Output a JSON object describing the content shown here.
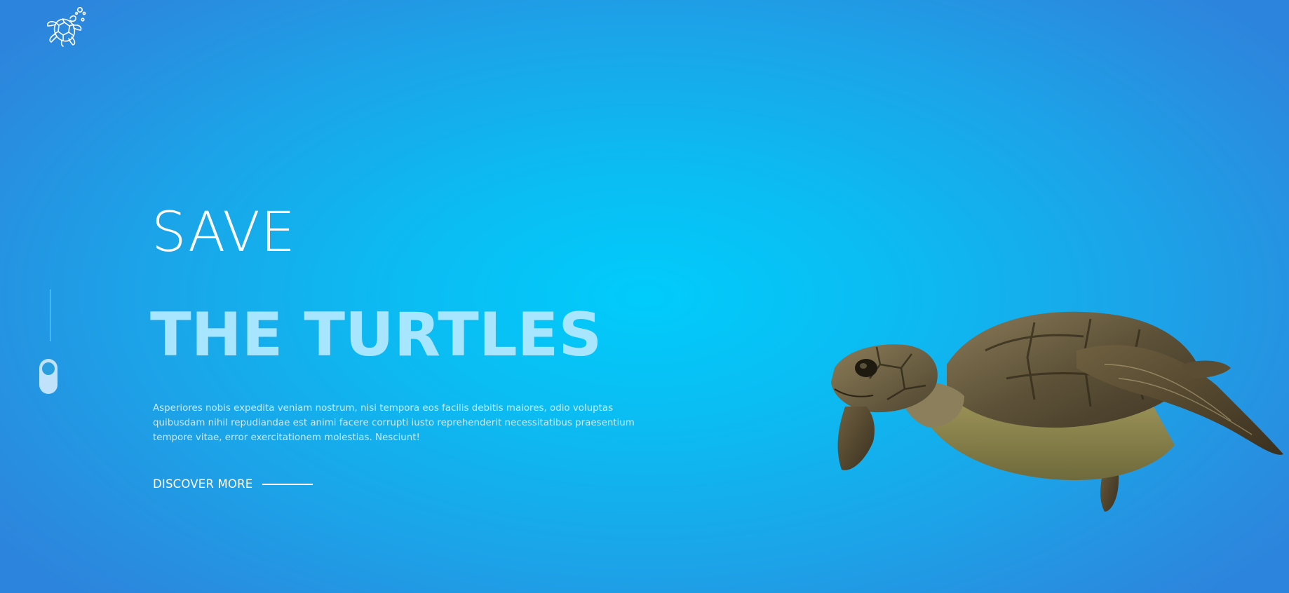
{
  "brand": {
    "logo_icon": "sea-turtle-icon"
  },
  "hero": {
    "line1": "SAVE",
    "line2": "THE TURTLES",
    "description": "Asperiores nobis expedita veniam nostrum, nisi tempora eos facilis debitis maiores, odio voluptas quibusdam nihil repudiandae est animi facere corrupti iusto reprehenderit necessitatibus praesentium tempore vitae, error exercitationem molestias. Nesciunt!",
    "cta_label": "DISCOVER MORE"
  },
  "colors": {
    "background_center": "#00ccfb",
    "background_edge": "#2d84dc",
    "accent_text": "#a8e6ff"
  }
}
